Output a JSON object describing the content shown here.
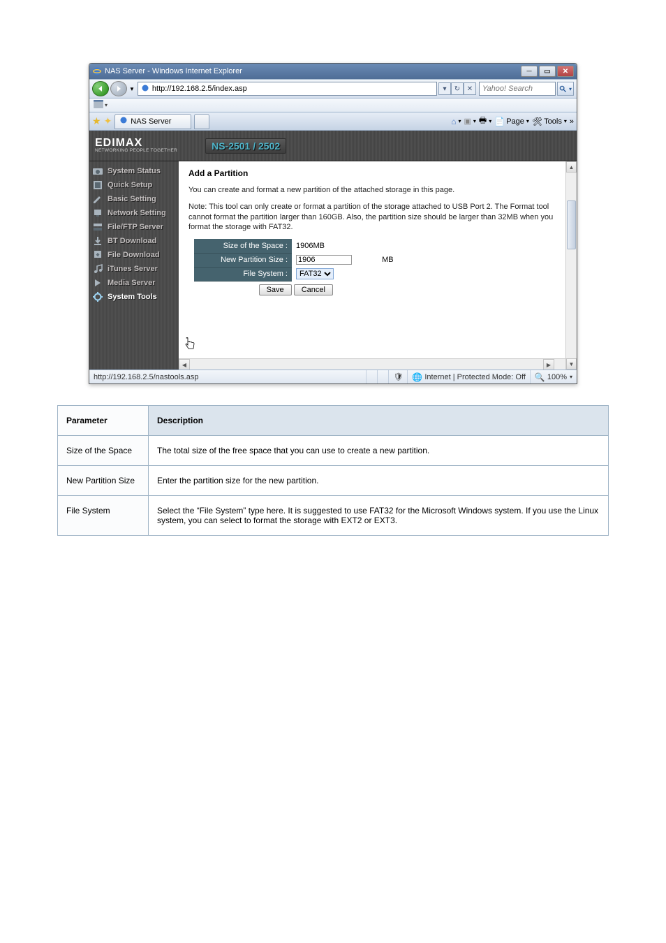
{
  "window": {
    "title": "NAS Server - Windows Internet Explorer",
    "url": "http://192.168.2.5/index.asp",
    "search_placeholder": "Yahoo! Search",
    "tab_label": "NAS Server",
    "toolbar_page": "Page",
    "toolbar_tools": "Tools",
    "overflow": "»"
  },
  "brand": {
    "name": "EDIMAX",
    "tag": "NETWORKING PEOPLE TOGETHER",
    "model": "NS-2501 / 2502"
  },
  "sidebar": {
    "items": [
      {
        "label": "System Status"
      },
      {
        "label": "Quick Setup"
      },
      {
        "label": "Basic Setting"
      },
      {
        "label": "Network Setting"
      },
      {
        "label": "File/FTP Server"
      },
      {
        "label": "BT Download"
      },
      {
        "label": "File Download"
      },
      {
        "label": "iTunes Server"
      },
      {
        "label": "Media Server"
      },
      {
        "label": "System Tools"
      }
    ]
  },
  "main": {
    "title": "Add a Partition",
    "intro": "You can create and format a new partition of the attached storage in this page.",
    "note": "Note: This tool can only create or format a partition of the storage attached to USB Port 2. The Format tool cannot format the partition larger than 160GB. Also, the partition size should be larger than 32MB when you format the storage with FAT32.",
    "row_size_label": "Size of the Space :",
    "row_size_value": "1906MB",
    "row_newsize_label": "New Partition Size :",
    "row_newsize_value": "1906",
    "row_newsize_unit": "MB",
    "row_fs_label": "File System :",
    "row_fs_value": "FAT32",
    "save": "Save",
    "cancel": "Cancel"
  },
  "statusbar": {
    "left": "http://192.168.2.5/nastools.asp",
    "zone": "Internet | Protected Mode: Off",
    "zoom": "100%"
  },
  "infotable": {
    "header_param": "Parameter",
    "header_desc": "Description",
    "r1p": "Size of the Space",
    "r1d": "The total size of the free space that you can use to create a new partition.",
    "r2p": "New Partition Size",
    "r2d": "Enter the partition size for the new partition.",
    "r3p": "File System",
    "r3d": "Select the “File System” type here. It is suggested to use FAT32 for the Microsoft Windows system. If you use the Linux system, you can select to format the storage with EXT2 or EXT3."
  }
}
